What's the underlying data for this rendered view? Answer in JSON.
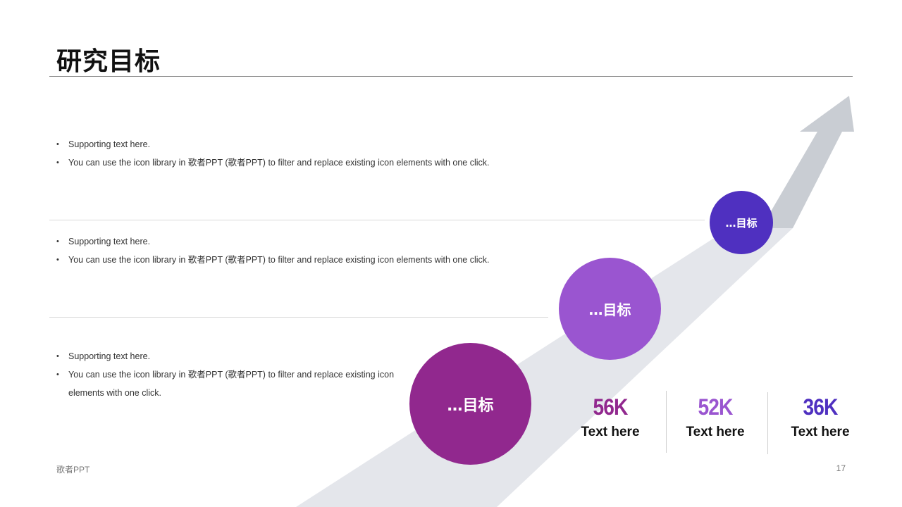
{
  "title": "研究目标",
  "sections": [
    {
      "bullets": [
        "Supporting text here.",
        "You can use the icon library in 歌者PPT (歌者PPT) to filter and replace existing icon elements with one click."
      ]
    },
    {
      "bullets": [
        "Supporting text here.",
        "You can use the icon library in 歌者PPT (歌者PPT) to filter and replace existing icon elements with one click."
      ]
    },
    {
      "bullets": [
        "Supporting text here.",
        "You can use the icon library in 歌者PPT (歌者PPT) to filter and replace existing icon elements with one click."
      ]
    }
  ],
  "circles": [
    {
      "label": "…目标",
      "color": "#91288e"
    },
    {
      "label": "…目标",
      "color": "#9a55d0"
    },
    {
      "label": "…目标",
      "color": "#4f30c0"
    }
  ],
  "stats": [
    {
      "value": "56K",
      "label": "Text here",
      "color": "#91288e"
    },
    {
      "value": "52K",
      "label": "Text here",
      "color": "#9a55d0"
    },
    {
      "value": "36K",
      "label": "Text here",
      "color": "#4f30c0"
    }
  ],
  "footer": {
    "brand": "歌者PPT",
    "page_number": "17"
  },
  "colors": {
    "arrow_light": "#e4e6eb",
    "arrow_head": "#c9cdd3"
  }
}
